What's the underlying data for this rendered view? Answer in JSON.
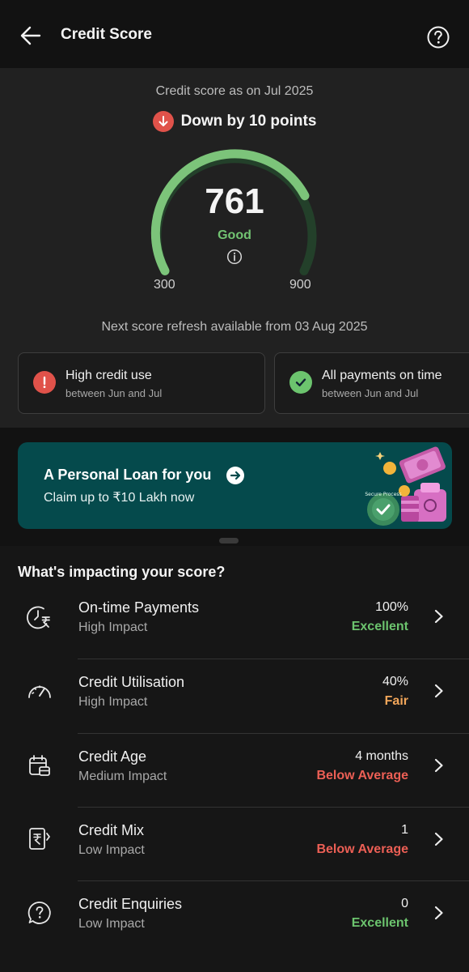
{
  "header": {
    "title": "Credit Score"
  },
  "score": {
    "as_of": "Credit score as on Jul 2025",
    "change": "Down by 10 points",
    "value": "761",
    "rating": "Good",
    "min": "300",
    "max": "900",
    "refresh": "Next score refresh available from 03 Aug 2025"
  },
  "insights": [
    {
      "title": "High credit use",
      "subtitle": "between Jun and Jul",
      "icon": "alert-icon",
      "color": "#e0524a"
    },
    {
      "title": "All payments on time",
      "subtitle": "between Jun and Jul",
      "icon": "check-icon",
      "color": "#6cc46e"
    }
  ],
  "banner": {
    "title": "A Personal Loan for you",
    "subtitle": "Claim up to ₹10 Lakh now",
    "badge": "Secure Process"
  },
  "impact": {
    "heading": "What's impacting your score?",
    "rows": [
      {
        "name": "On-time Payments",
        "impact": "High Impact",
        "value": "100%",
        "status": "Excellent",
        "status_color": "#6cc46e",
        "icon": "clock-rupee-icon"
      },
      {
        "name": "Credit Utilisation",
        "impact": "High Impact",
        "value": "40%",
        "status": "Fair",
        "status_color": "#f2a65a",
        "icon": "speedometer-icon"
      },
      {
        "name": "Credit Age",
        "impact": "Medium Impact",
        "value": "4 months",
        "status": "Below Average",
        "status_color": "#ec5f55",
        "icon": "calendar-icon"
      },
      {
        "name": "Credit Mix",
        "impact": "Low Impact",
        "value": "1",
        "status": "Below Average",
        "status_color": "#ec5f55",
        "icon": "rupee-card-icon"
      },
      {
        "name": "Credit Enquiries",
        "impact": "Low Impact",
        "value": "0",
        "status": "Excellent",
        "status_color": "#6cc46e",
        "icon": "question-bubble-icon"
      }
    ]
  },
  "colors": {
    "gauge_active": "#7cc47a",
    "gauge_inactive": "#23402a",
    "banner_bg": "#054a4c"
  }
}
